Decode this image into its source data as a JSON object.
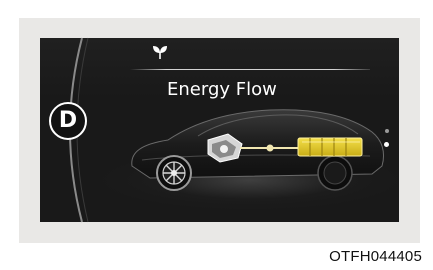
{
  "display": {
    "gear": "D",
    "eco_icon": "eco-sprout-icon",
    "title": "Energy Flow",
    "page_indicator": {
      "total": 2,
      "active": 2
    }
  },
  "energy_flow": {
    "car_icon": "car-silhouette-icon",
    "motor_icon": "electric-motor-icon",
    "battery_icon": "battery-icon",
    "flow_direction": "battery-to-motor",
    "battery_color": "#e8cf2a",
    "flow_line_color": "#f0e6b0"
  },
  "caption": {
    "code": "OTFH044405"
  },
  "colors": {
    "screen_bg": "#191919",
    "frame_bg": "#e9e8e6",
    "accent": "#ffffff"
  }
}
